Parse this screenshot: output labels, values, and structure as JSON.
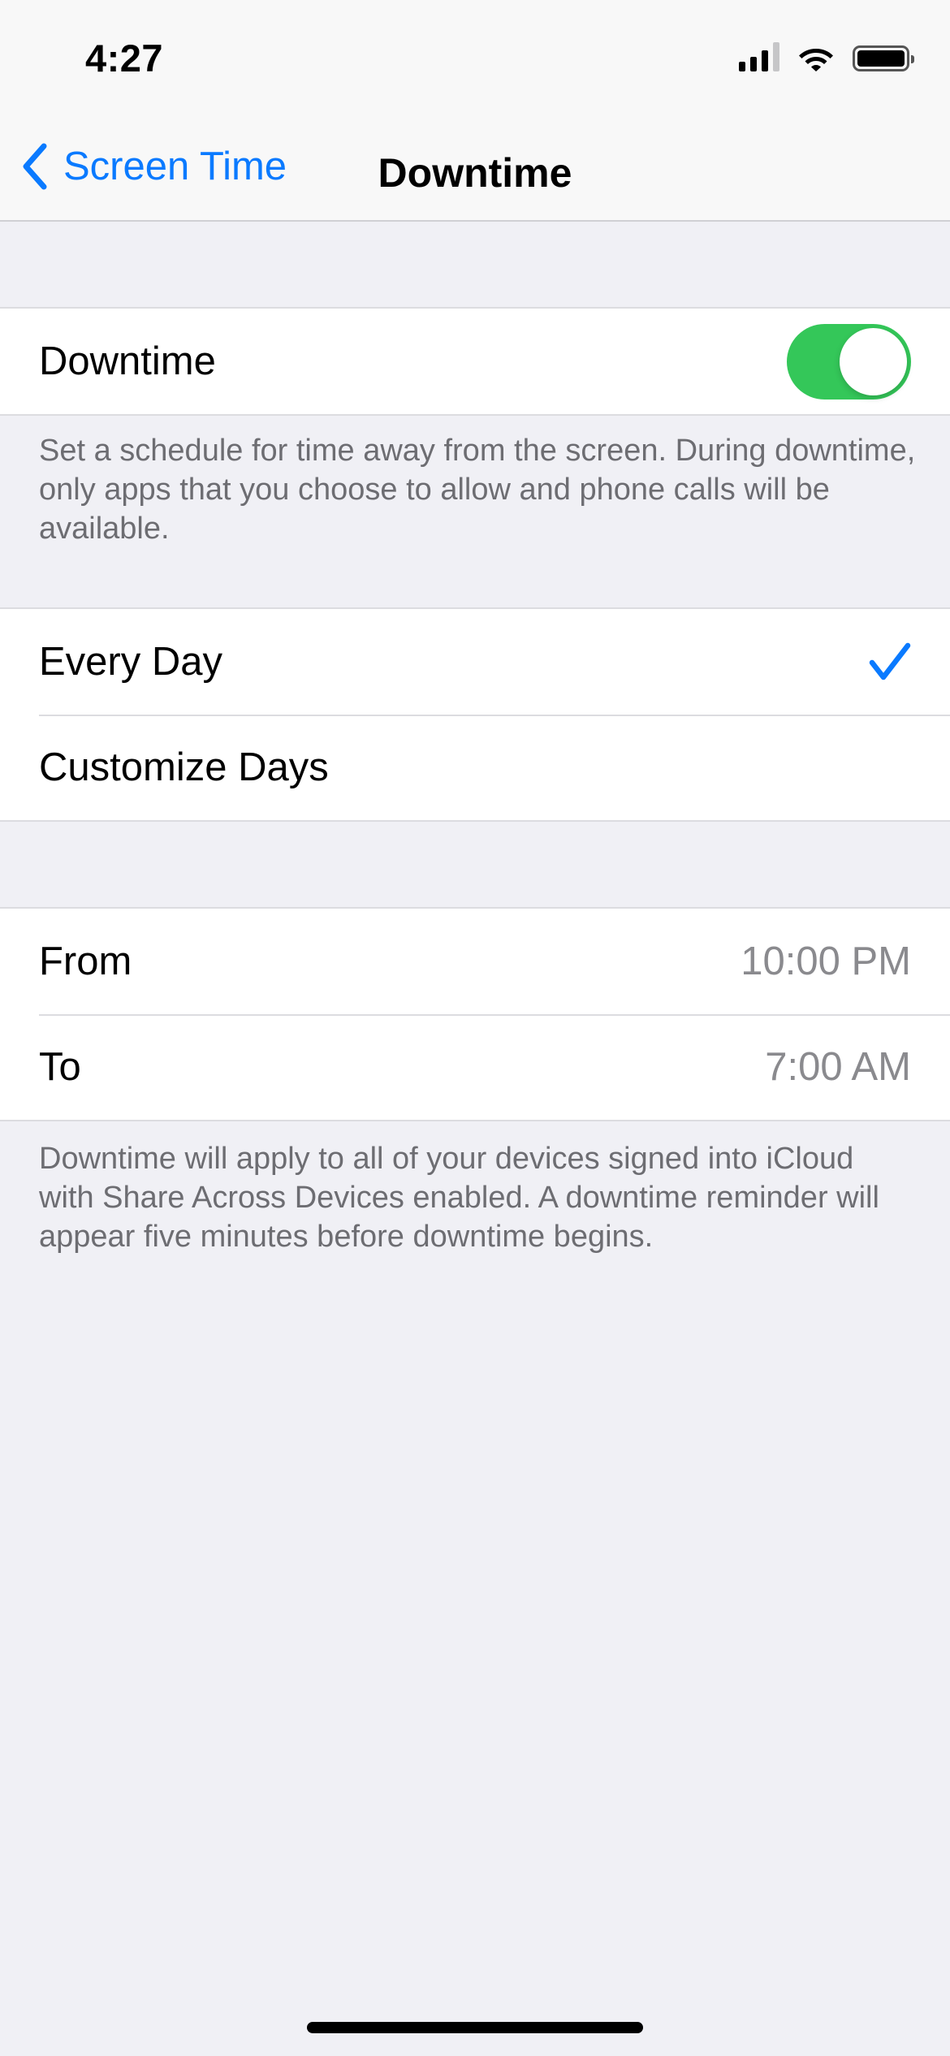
{
  "status_bar": {
    "time": "4:27"
  },
  "nav": {
    "back_label": "Screen Time",
    "title": "Downtime"
  },
  "downtime_toggle": {
    "label": "Downtime",
    "on": true
  },
  "downtime_description": "Set a schedule for time away from the screen. During downtime, only apps that you choose to allow and phone calls will be available.",
  "schedule": {
    "every_day_label": "Every Day",
    "customize_days_label": "Customize Days",
    "selected": "Every Day"
  },
  "times": {
    "from_label": "From",
    "from_value": "10:00 PM",
    "to_label": "To",
    "to_value": "7:00 AM"
  },
  "footer_description": "Downtime will apply to all of your devices signed into iCloud with Share Across Devices enabled. A downtime reminder will appear five minutes before downtime begins.",
  "colors": {
    "accent": "#0a7aff",
    "toggle_on": "#34c759",
    "background": "#f0f0f5"
  }
}
